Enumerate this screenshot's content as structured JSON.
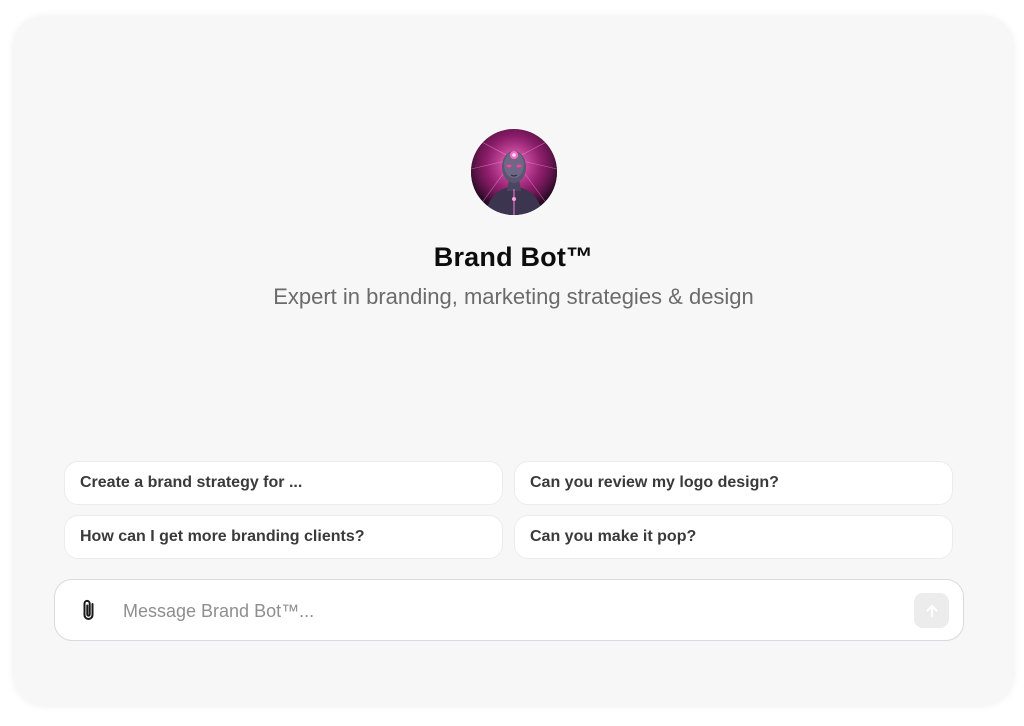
{
  "bot": {
    "name": "Brand Bot™",
    "description": "Expert in branding, marketing strategies & design",
    "avatar_icon": "cyber-figure-avatar"
  },
  "suggestions": [
    "Create a brand strategy for ...",
    "Can you review my logo design?",
    "How can I get more branding clients?",
    "Can you make it pop?"
  ],
  "composer": {
    "placeholder": "Message Brand Bot™...",
    "value": "",
    "attach_icon": "paperclip-icon",
    "send_icon": "arrow-up-icon"
  },
  "colors": {
    "background": "#f7f7f8",
    "card": "#ffffff",
    "send_button": "#ececec",
    "avatar_accent": "#b6338f"
  }
}
